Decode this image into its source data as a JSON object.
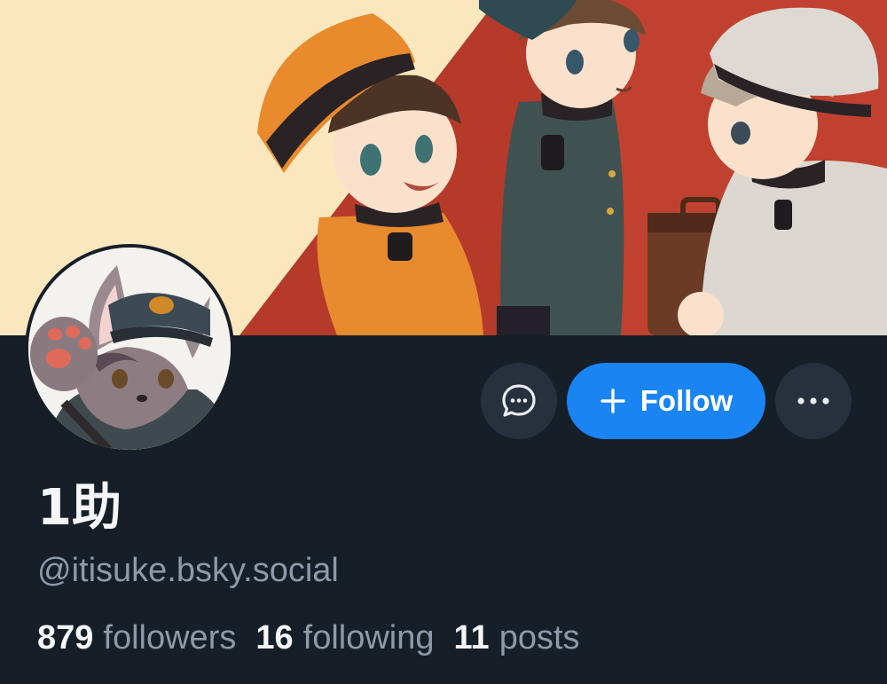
{
  "profile": {
    "display_name": "1助",
    "handle": "@itisuke.bsky.social"
  },
  "actions": {
    "message_icon": "chat-bubble-icon",
    "follow_label": "Follow",
    "follow_icon": "plus-icon",
    "more_icon": "ellipsis-icon"
  },
  "stats": {
    "followers_count": "879",
    "followers_label": "followers",
    "following_count": "16",
    "following_label": "following",
    "posts_count": "11",
    "posts_label": "posts"
  },
  "colors": {
    "background": "#161e27",
    "accent": "#1a84f2",
    "secondary_button": "#26313d",
    "muted_text": "#8e9aa8"
  }
}
